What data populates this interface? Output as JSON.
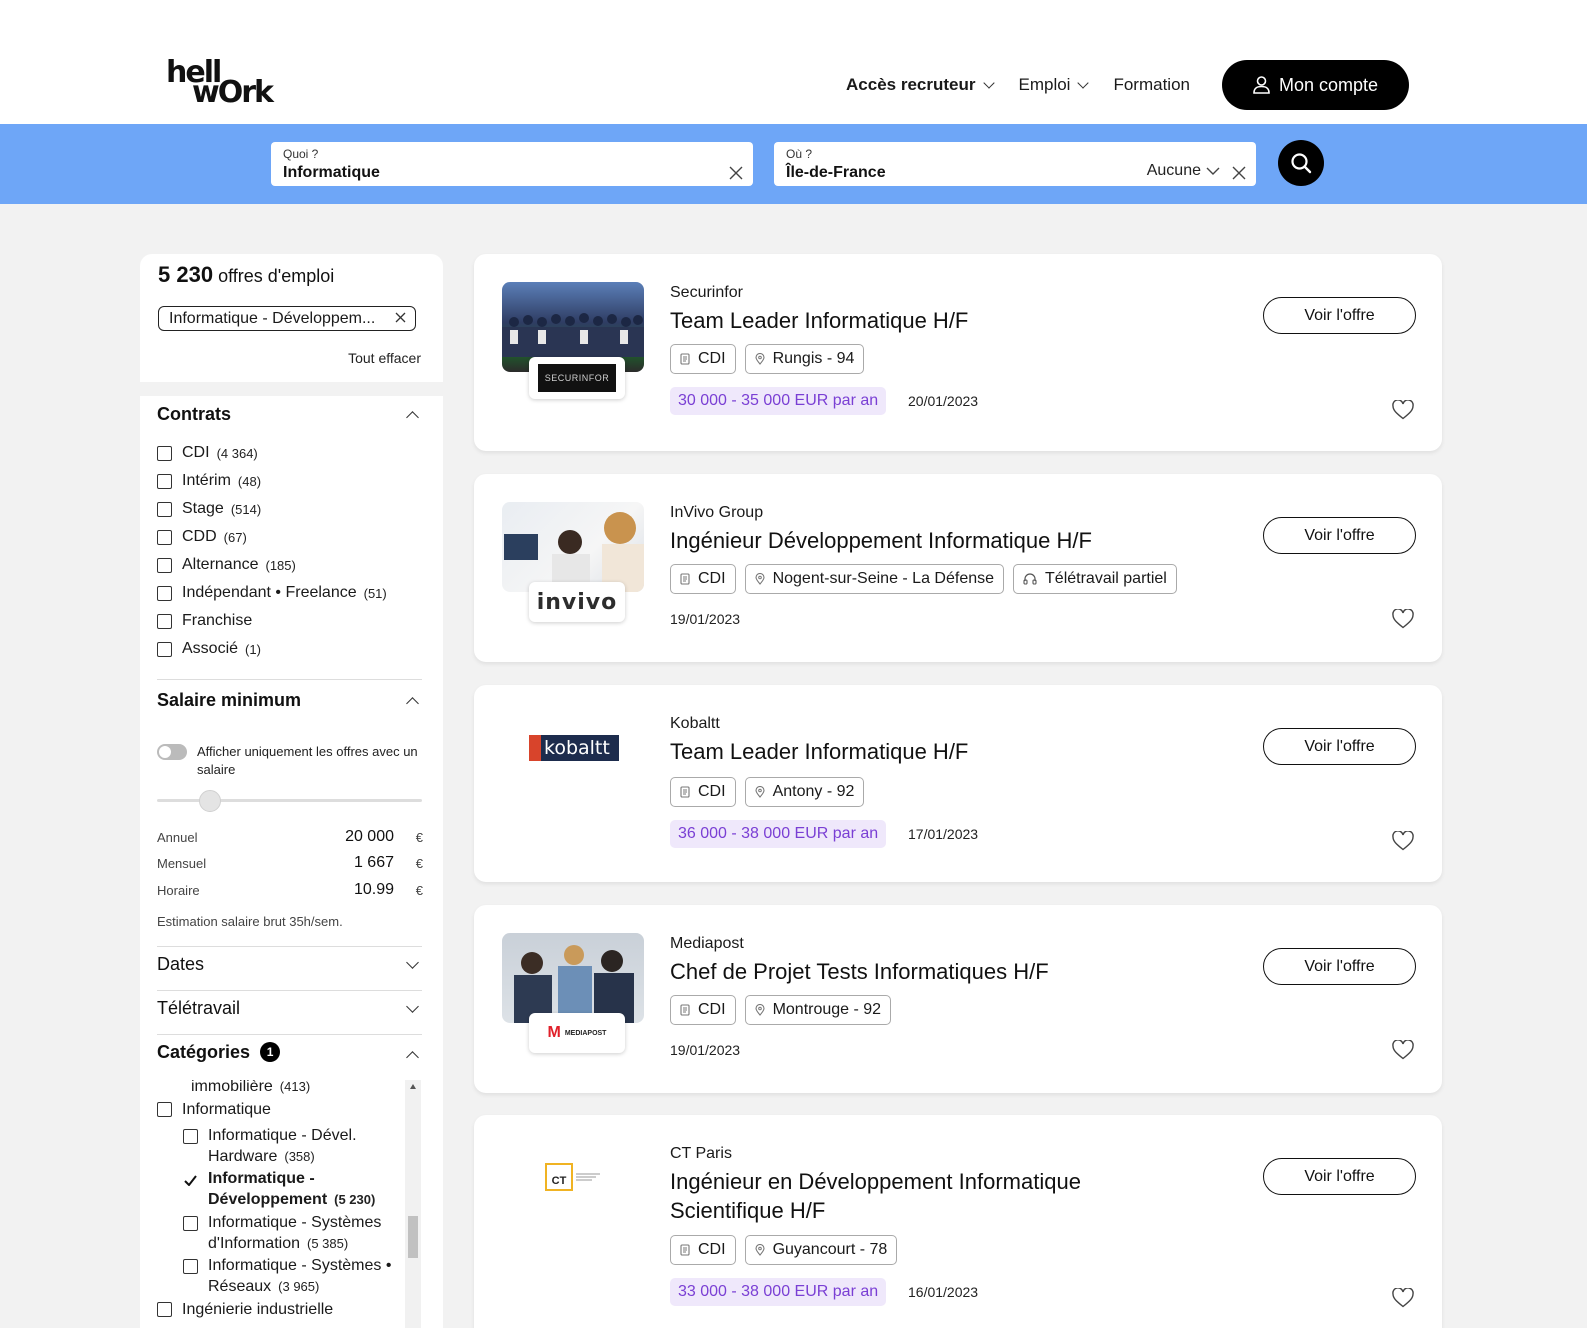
{
  "header": {
    "logo_line1": "hell",
    "logo_line2": "wOrk",
    "nav": {
      "recruiter": "Accès recruteur",
      "emploi": "Emploi",
      "formation": "Formation",
      "account": "Mon compte"
    }
  },
  "search": {
    "what_label": "Quoi ?",
    "what_value": "Informatique",
    "where_label": "Où ?",
    "where_value": "Île-de-France",
    "radius": "Aucune"
  },
  "sidebar": {
    "count_number": "5 230",
    "count_label": "offres d'emploi",
    "active_filter": "Informatique - Développem...",
    "clear_all": "Tout effacer",
    "contrats": {
      "title": "Contrats",
      "items": [
        {
          "label": "CDI",
          "count": "(4 364)"
        },
        {
          "label": "Intérim",
          "count": "(48)"
        },
        {
          "label": "Stage",
          "count": "(514)"
        },
        {
          "label": "CDD",
          "count": "(67)"
        },
        {
          "label": "Alternance",
          "count": "(185)"
        },
        {
          "label": "Indépendant • Freelance",
          "count": "(51)"
        },
        {
          "label": "Franchise",
          "count": ""
        },
        {
          "label": "Associé",
          "count": "(1)"
        }
      ]
    },
    "salaire": {
      "title": "Salaire minimum",
      "toggle_label": "Afficher uniquement les offres avec un salaire",
      "slider_fraction": 0.2,
      "annuel_label": "Annuel",
      "annuel_value": "20 000",
      "mensuel_label": "Mensuel",
      "mensuel_value": "1 667",
      "horaire_label": "Horaire",
      "horaire_value": "10.99",
      "currency": "€",
      "estimation": "Estimation salaire brut 35h/sem."
    },
    "dates_title": "Dates",
    "teletravail_title": "Télétravail",
    "categories": {
      "title": "Catégories",
      "badge": "1",
      "immobiliere_label": "immobilière",
      "immobiliere_count": "(413)",
      "informatique": "Informatique",
      "hardware_l1": "Informatique - Dével.",
      "hardware_l2": "Hardware",
      "hardware_count": "(358)",
      "dev_l1": "Informatique -",
      "dev_l2": "Développement",
      "dev_count": "(5 230)",
      "si_l1": "Informatique - Systèmes",
      "si_l2": "d'Information",
      "si_count": "(5 385)",
      "reseaux_l1": "Informatique - Systèmes •",
      "reseaux_l2": "Réseaux",
      "reseaux_count": "(3 965)",
      "ingenierie": "Ingénierie industrielle"
    }
  },
  "jobs": [
    {
      "company": "Securinfor",
      "title": "Team Leader Informatique H/F",
      "contract": "CDI",
      "location": "Rungis - 94",
      "remote": "",
      "salary": "30 000 - 35 000 EUR par an",
      "date": "20/01/2023",
      "cta": "Voir l'offre",
      "logo_text": "SECURINFOR"
    },
    {
      "company": "InVivo Group",
      "title": "Ingénieur Développement Informatique H/F",
      "contract": "CDI",
      "location": "Nogent-sur-Seine - La Défense",
      "remote": "Télétravail partiel",
      "salary": "",
      "date": "19/01/2023",
      "cta": "Voir l'offre",
      "logo_text": "invivo"
    },
    {
      "company": "Kobaltt",
      "title": "Team Leader Informatique H/F",
      "contract": "CDI",
      "location": "Antony - 92",
      "remote": "",
      "salary": "36 000 - 38 000 EUR par an",
      "date": "17/01/2023",
      "cta": "Voir l'offre",
      "logo_text": "kobaltt"
    },
    {
      "company": "Mediapost",
      "title": "Chef de Projet Tests Informatiques H/F",
      "contract": "CDI",
      "location": "Montrouge - 92",
      "remote": "",
      "salary": "",
      "date": "19/01/2023",
      "cta": "Voir l'offre",
      "logo_text": "MEDIAPOST"
    },
    {
      "company": "CT Paris",
      "title": "Ingénieur en Développement Informatique Scientifique H/F",
      "contract": "CDI",
      "location": "Guyancourt - 78",
      "remote": "",
      "salary": "33 000 - 38 000 EUR par an",
      "date": "16/01/2023",
      "cta": "Voir l'offre",
      "logo_text": "CT"
    }
  ]
}
